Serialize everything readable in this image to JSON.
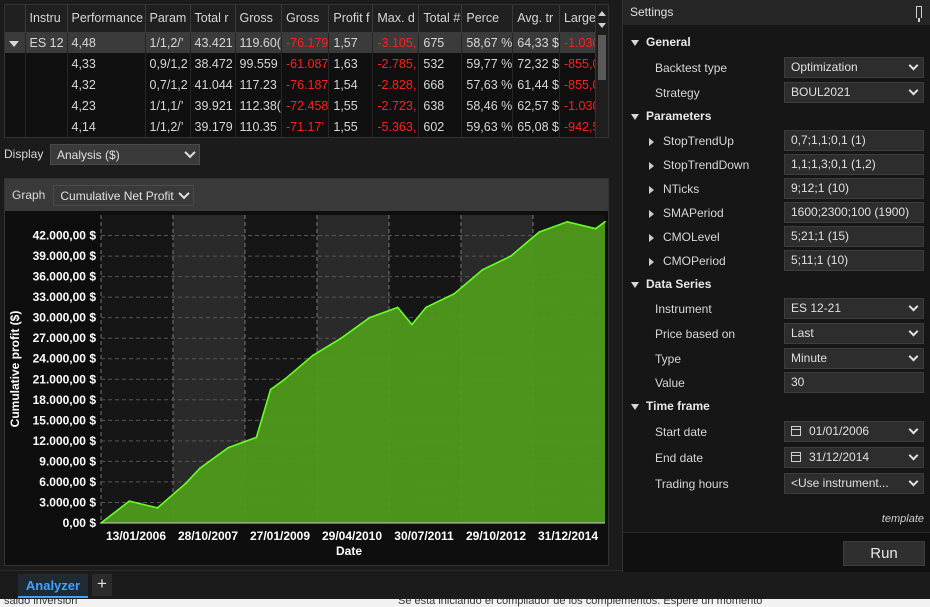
{
  "results": {
    "columns": [
      "Instru",
      "Performance",
      "Param",
      "Total r",
      "Gross",
      "Gross",
      "Profit f",
      "Max. d",
      "Total #",
      "Perce",
      "Avg. tr",
      "Large"
    ],
    "rows": [
      {
        "instrument": "ES 12",
        "perf": "4,48",
        "param": "1/1,2/’",
        "total_r": "43.421",
        "gross_p": "119.60(",
        "gross_l": "-76.179",
        "profit_f": "1,57",
        "max_d": "-3.105,",
        "total_n": "675",
        "perce": "58,67 %",
        "avg_tr": "64,33 $",
        "large": "-1.030,"
      },
      {
        "instrument": "",
        "perf": "4,33",
        "param": "0,9/1,2",
        "total_r": "38.472",
        "gross_p": "99.559",
        "gross_l": "-61.087",
        "profit_f": "1,63",
        "max_d": "-2.785,",
        "total_n": "532",
        "perce": "59,77 %",
        "avg_tr": "72,32 $",
        "large": "-855,08"
      },
      {
        "instrument": "",
        "perf": "4,32",
        "param": "0,7/1,2",
        "total_r": "41.044",
        "gross_p": "117.23",
        "gross_l": "-76.187",
        "profit_f": "1,54",
        "max_d": "-2.828,",
        "total_n": "668",
        "perce": "57,63 %",
        "avg_tr": "61,44 $",
        "large": "-855,08"
      },
      {
        "instrument": "",
        "perf": "4,23",
        "param": "1/1,1/’",
        "total_r": "39.921",
        "gross_p": "112.38(",
        "gross_l": "-72.458",
        "profit_f": "1,55",
        "max_d": "-2.723,",
        "total_n": "638",
        "perce": "58,46 %",
        "avg_tr": "62,57 $",
        "large": "-1.030,"
      },
      {
        "instrument": "",
        "perf": "4,14",
        "param": "1/1,2/’",
        "total_r": "39.179",
        "gross_p": "110.35",
        "gross_l": "-71.17’",
        "profit_f": "1,55",
        "max_d": "-5.363,",
        "total_n": "602",
        "perce": "59,63 %",
        "avg_tr": "65,08 $",
        "large": "-942,58"
      }
    ]
  },
  "display": {
    "label": "Display",
    "value": "Analysis ($)"
  },
  "graph": {
    "label": "Graph",
    "value": "Cumulative Net Profit"
  },
  "chart_data": {
    "type": "area",
    "title": "",
    "xlabel": "Date",
    "ylabel": "Cumulative profit ($)",
    "ylim": [
      0,
      45000
    ],
    "y_ticks": [
      "0,00 $",
      "3.000,00 $",
      "6.000,00 $",
      "9.000,00 $",
      "12.000,00 $",
      "15.000,00 $",
      "18.000,00 $",
      "21.000,00 $",
      "24.000,00 $",
      "27.000,00 $",
      "30.000,00 $",
      "33.000,00 $",
      "36.000,00 $",
      "39.000,00 $",
      "42.000,00 $"
    ],
    "x_ticks": [
      "13/01/2006",
      "28/10/2007",
      "27/01/2009",
      "29/04/2010",
      "30/07/2011",
      "29/10/2012",
      "31/12/2014"
    ],
    "grid": true,
    "fill_color": "#4f9a1c",
    "line_color": "#66ff22",
    "x": [
      "2006-01",
      "2006-07",
      "2007-01",
      "2007-07",
      "2007-10",
      "2008-04",
      "2008-10",
      "2009-01",
      "2009-04",
      "2009-10",
      "2010-04",
      "2010-10",
      "2011-04",
      "2011-07",
      "2011-10",
      "2012-04",
      "2012-10",
      "2013-04",
      "2013-10",
      "2014-04",
      "2014-10",
      "2014-12"
    ],
    "values": [
      0,
      3200,
      2200,
      5800,
      8000,
      11000,
      12500,
      19500,
      21000,
      24500,
      27000,
      30000,
      31500,
      29000,
      31500,
      33500,
      37000,
      39000,
      42500,
      44000,
      43000,
      44000
    ]
  },
  "tabs": {
    "active": "Analyzer",
    "add": "+"
  },
  "bottom_strip": {
    "left": "saldo inversión",
    "center": "Se está iniciando el compilador de los complementos. Espere un momento"
  },
  "settings": {
    "title": "Settings",
    "groups": {
      "general": "General",
      "parameters": "Parameters",
      "data_series": "Data Series",
      "time_frame": "Time frame"
    },
    "backtest_type": {
      "label": "Backtest type",
      "value": "Optimization"
    },
    "strategy": {
      "label": "Strategy",
      "value": "BOUL2021"
    },
    "params": [
      {
        "label": "StopTrendUp",
        "value": "0,7;1,1;0,1 (1)"
      },
      {
        "label": "StopTrendDown",
        "value": "1,1;1,3;0,1 (1,2)"
      },
      {
        "label": "NTicks",
        "value": "9;12;1 (10)"
      },
      {
        "label": "SMAPeriod",
        "value": "1600;2300;100 (1900)"
      },
      {
        "label": "CMOLevel",
        "value": "5;21;1 (15)"
      },
      {
        "label": "CMOPeriod",
        "value": "5;11;1 (10)"
      }
    ],
    "instrument": {
      "label": "Instrument",
      "value": "ES 12-21"
    },
    "price_based_on": {
      "label": "Price based on",
      "value": "Last"
    },
    "type": {
      "label": "Type",
      "value": "Minute"
    },
    "value": {
      "label": "Value",
      "value": "30"
    },
    "start_date": {
      "label": "Start date",
      "value": "01/01/2006"
    },
    "end_date": {
      "label": "End date",
      "value": "31/12/2014"
    },
    "trading_hours": {
      "label": "Trading hours",
      "value": "<Use instrument..."
    },
    "template": "template",
    "run": "Run"
  }
}
